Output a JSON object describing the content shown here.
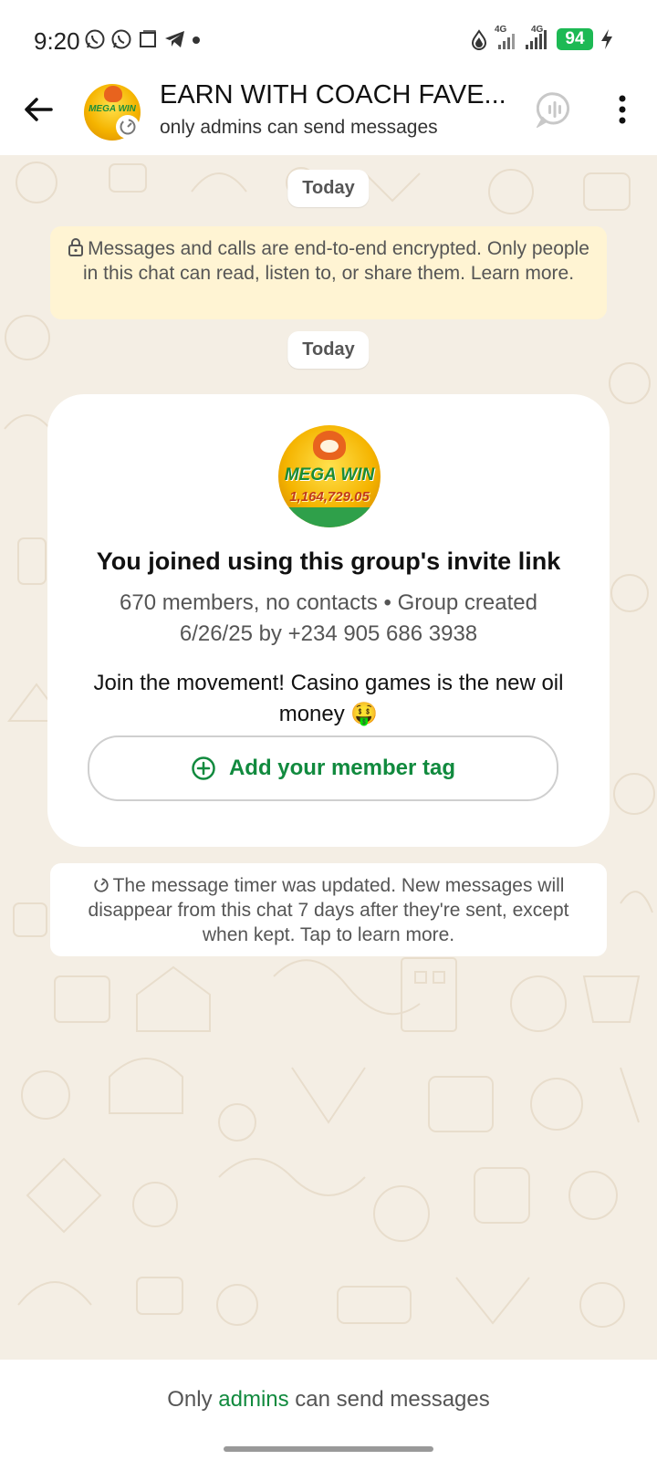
{
  "status_bar": {
    "time": "9:20",
    "network_1": "4G",
    "network_2": "4G",
    "battery": "94",
    "icons": [
      "whatsapp-icon",
      "whatsapp-icon",
      "square-icon",
      "telegram-icon",
      "dot-icon",
      "water-drop-icon",
      "signal-icon",
      "signal-icon",
      "charging-bolt-icon"
    ]
  },
  "header": {
    "title": "EARN WITH COACH FAVE...",
    "subtitle": "only admins can send messages",
    "avatar_text": "MEGA WIN",
    "icons": [
      "back-arrow-icon",
      "voice-chat-icon",
      "more-vert-icon",
      "timer-icon"
    ]
  },
  "chat": {
    "date_chip_1": "Today",
    "encryption_notice": "Messages and calls are end-to-end encrypted. Only people in this chat can read, listen to, or share them. Learn more.",
    "date_chip_2": "Today",
    "card": {
      "avatar_text": "MEGA WIN",
      "avatar_number": "1,164,729.05",
      "heading": "You joined using this group's invite link",
      "meta": "670 members, no contacts • Group created 6/26/25 by +234 905 686 3938",
      "description": "Join the movement! Casino games is the new oil money 🤑",
      "add_tag_label": "Add your member tag"
    },
    "timer_notice": "The message timer was updated. New messages will disappear from this chat 7 days after they're sent, except when kept. Tap to learn more."
  },
  "footer": {
    "text_before": "Only ",
    "link": "admins",
    "text_after": " can send messages"
  },
  "colors": {
    "accent_green": "#118a3e",
    "battery_green": "#1db954",
    "encryption_bg": "#fff4d3",
    "chat_bg": "#f4eee4"
  }
}
